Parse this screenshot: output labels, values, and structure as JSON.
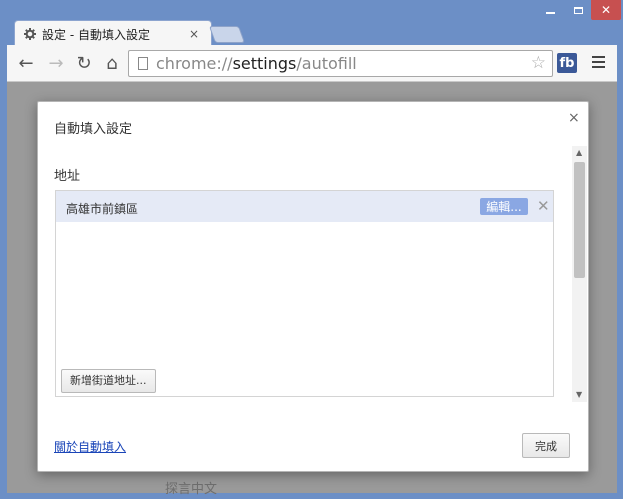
{
  "window": {
    "minimize_glyph": "—",
    "maximize_glyph": "☐",
    "close_glyph": "✕"
  },
  "tab": {
    "title": "設定 - 自動填入設定",
    "icon": "gear-icon",
    "close_glyph": "×"
  },
  "toolbar": {
    "back_glyph": "←",
    "forward_glyph": "→",
    "reload_glyph": "↻",
    "home_glyph": "⌂",
    "url_scheme": "chrome://",
    "url_host": "settings",
    "url_path": "/autofill",
    "star_glyph": "☆",
    "extension_label": "fb"
  },
  "background_page": {
    "partial_text": "探言中文"
  },
  "dialog": {
    "title": "自動填入設定",
    "close_glyph": "×",
    "section_title": "地址",
    "addresses": [
      {
        "label": "高雄市前鎮區",
        "edit_label": "編輯...",
        "delete_glyph": "✕"
      }
    ],
    "add_button_label": "新增街道地址...",
    "help_link": "關於自動填入",
    "done_button_label": "完成"
  },
  "colors": {
    "frame": "#6c8fc6",
    "close_button": "#c75050",
    "selected_row": "#e5eaf6",
    "edit_button": "#8aa7e3",
    "link": "#1a45b8"
  }
}
